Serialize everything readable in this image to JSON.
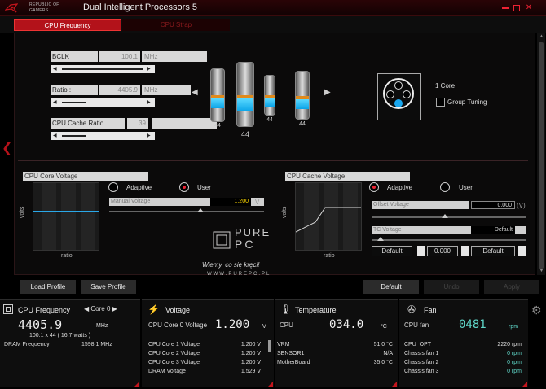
{
  "titlebar": {
    "brand_line1": "REPUBLIC OF",
    "brand_line2": "GAMERS",
    "title": "Dual Intelligent Processors 5"
  },
  "tabs": [
    {
      "label": "CPU Frequency",
      "active": true
    },
    {
      "label": "CPU Strap",
      "active": false
    }
  ],
  "params": {
    "bclk": {
      "label": "BCLK Frequency",
      "value": "100.1",
      "unit": "MHz"
    },
    "ratio": {
      "label": "Ratio :",
      "value": "4405.9",
      "unit": "MHz"
    },
    "cache": {
      "label": "CPU Cache Ratio",
      "value": "39"
    }
  },
  "cores": {
    "labels": [
      "44",
      "44",
      "44",
      "44"
    ]
  },
  "group_tuning": {
    "core_count": "1 Core",
    "label": "Group Tuning"
  },
  "core_voltage": {
    "header": "CPU Core Voltage",
    "adaptive_label": "Adaptive",
    "user_label": "User",
    "selected": "user",
    "field_label": "Manual Voltage",
    "value": "1.200",
    "unit": "V",
    "y_label": "volts",
    "x_label": "ratio"
  },
  "cache_voltage": {
    "header": "CPU Cache Voltage",
    "adaptive_label": "Adaptive",
    "user_label": "User",
    "selected": "adaptive",
    "offset_label": "Offset Voltage",
    "offset_value": "0.000",
    "offset_unit": "(V)",
    "tc_label": "TC Voltage",
    "tc_value": "Default",
    "default_1": "Default",
    "middle_value": "0.000",
    "default_2": "Default",
    "y_label": "volts",
    "x_label": "ratio"
  },
  "watermark": {
    "brand_top": "PURE",
    "brand_bottom": "PC",
    "tagline": "Wiemy, co się kręci!",
    "url": "WWW.PUREPC.PL"
  },
  "actions": {
    "load_profile": "Load Profile",
    "save_profile": "Save Profile",
    "default": "Default",
    "undo": "Undo",
    "apply": "Apply"
  },
  "footer": {
    "cpu_frequency": {
      "title": "CPU Frequency",
      "selector": "Core 0",
      "main_value": "4405.9",
      "main_unit": "MHz",
      "sub_line": "100.1  x  44  ( 16.7   watts )",
      "dram_label": "DRAM Frequency",
      "dram_value": "1598.1  MHz"
    },
    "voltage": {
      "title": "Voltage",
      "main_label": "CPU Core 0 Voltage",
      "main_value": "1.200",
      "main_unit": "V",
      "rows": [
        {
          "label": "CPU Core 1 Voltage",
          "value": "1.200  V"
        },
        {
          "label": "CPU Core 2 Voltage",
          "value": "1.200  V"
        },
        {
          "label": "CPU Core 3 Voltage",
          "value": "1.200  V"
        },
        {
          "label": "DRAM Voltage",
          "value": "1.529  V"
        }
      ]
    },
    "temperature": {
      "title": "Temperature",
      "main_label": "CPU",
      "main_value": "034.0",
      "main_unit": "°C",
      "rows": [
        {
          "label": "VRM",
          "value": "51.0 °C"
        },
        {
          "label": "SENSOR1",
          "value": "N/A"
        },
        {
          "label": "MotherBoard",
          "value": "35.0 °C"
        }
      ]
    },
    "fan": {
      "title": "Fan",
      "main_label": "CPU fan",
      "main_value": "0481",
      "main_unit": "rpm",
      "rows": [
        {
          "label": "CPU_OPT",
          "value": "2220  rpm"
        },
        {
          "label": "Chassis fan 1",
          "value": "0  rpm"
        },
        {
          "label": "Chassis fan 2",
          "value": "0  rpm"
        },
        {
          "label": "Chassis fan 3",
          "value": "0  rpm"
        }
      ]
    }
  },
  "colors": {
    "accent_red": "#b3121a",
    "cyan_value": "#5fd6c8",
    "core_blue": "#0aa4e8",
    "core_orange": "#e08a1c"
  },
  "icons": [
    "rog-logo",
    "close-icon",
    "chevron-left-icon",
    "chevron-right-icon",
    "lightning-icon",
    "thermometer-icon",
    "fan-icon",
    "gear-icon",
    "cpu-icon"
  ]
}
